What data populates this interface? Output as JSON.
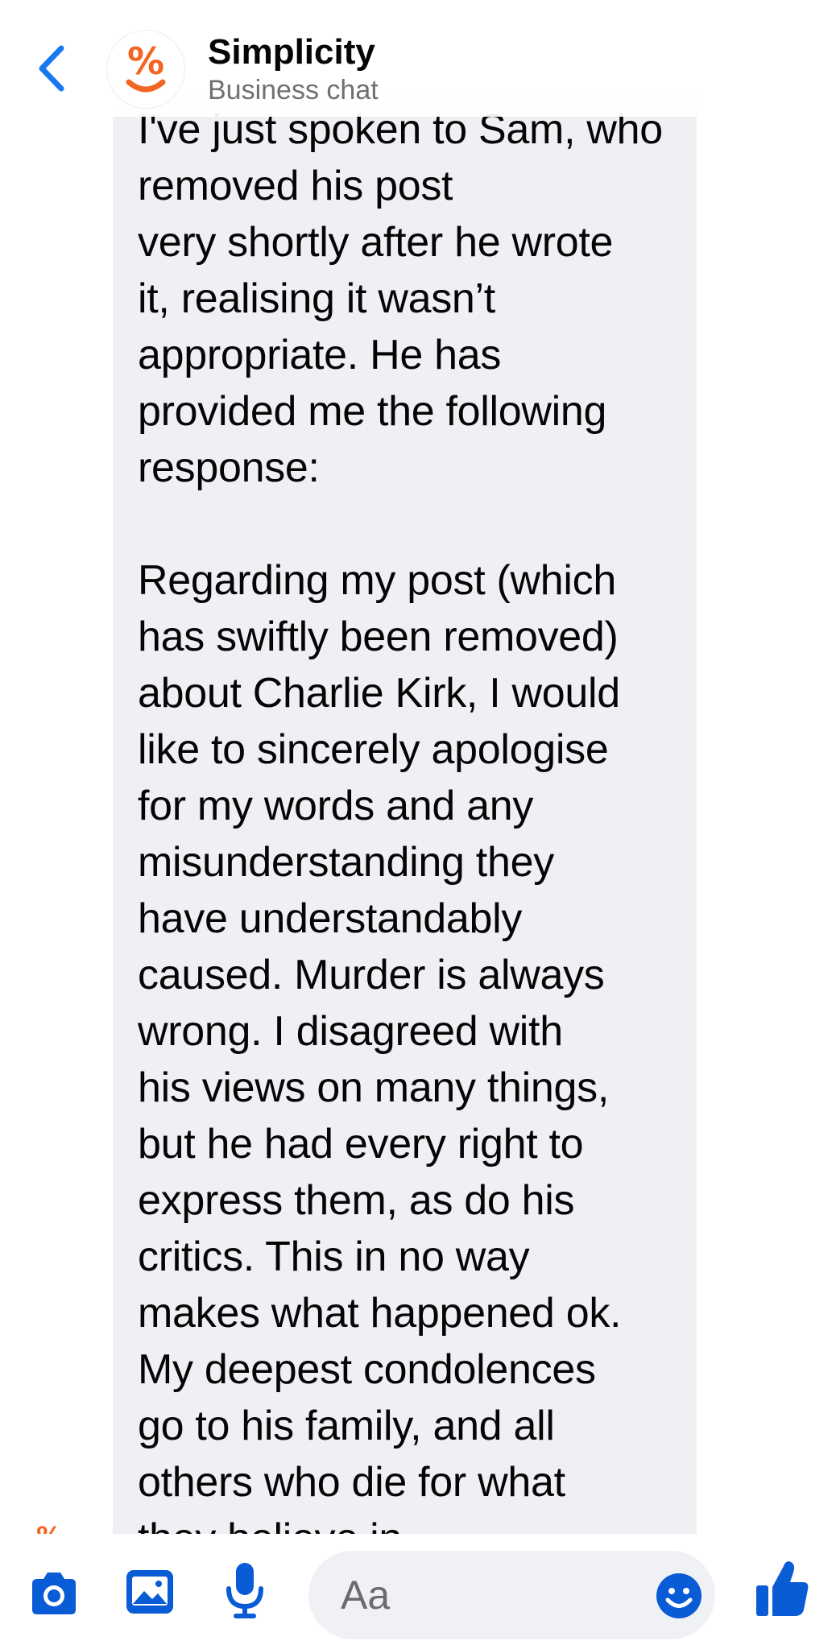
{
  "header": {
    "title": "Simplicity",
    "subtitle": "Business chat"
  },
  "avatar": {
    "glyph": "%",
    "brand_color": "#f26522"
  },
  "message": {
    "text": "I've just spoken to Sam, who removed his post\nvery shortly after he wrote\nit, realising it wasn’t\nappropriate. He has\nprovided me the following\nresponse:\n\nRegarding my post (which\nhas swiftly been removed)\nabout Charlie Kirk, I would\nlike to sincerely apologise\nfor my words and any\nmisunderstanding they\nhave understandably\ncaused. Murder is always\nwrong. I disagreed with\nhis views on many things,\nbut he had every right to\nexpress them, as do his\ncritics. This in no way\nmakes what happened ok.\nMy deepest condolences\ngo to his family, and all\nothers who die for what\nthey believe in."
  },
  "composer": {
    "placeholder": "Aa"
  },
  "toolbar": {
    "icons": [
      "camera-icon",
      "gallery-icon",
      "microphone-icon",
      "emoji-icon",
      "thumbs-up-icon"
    ],
    "accent_color": "#0a5bd6"
  },
  "colors": {
    "accent": "#1877f2",
    "bubble_bg": "#eff0f4",
    "brand_orange": "#f26522"
  }
}
